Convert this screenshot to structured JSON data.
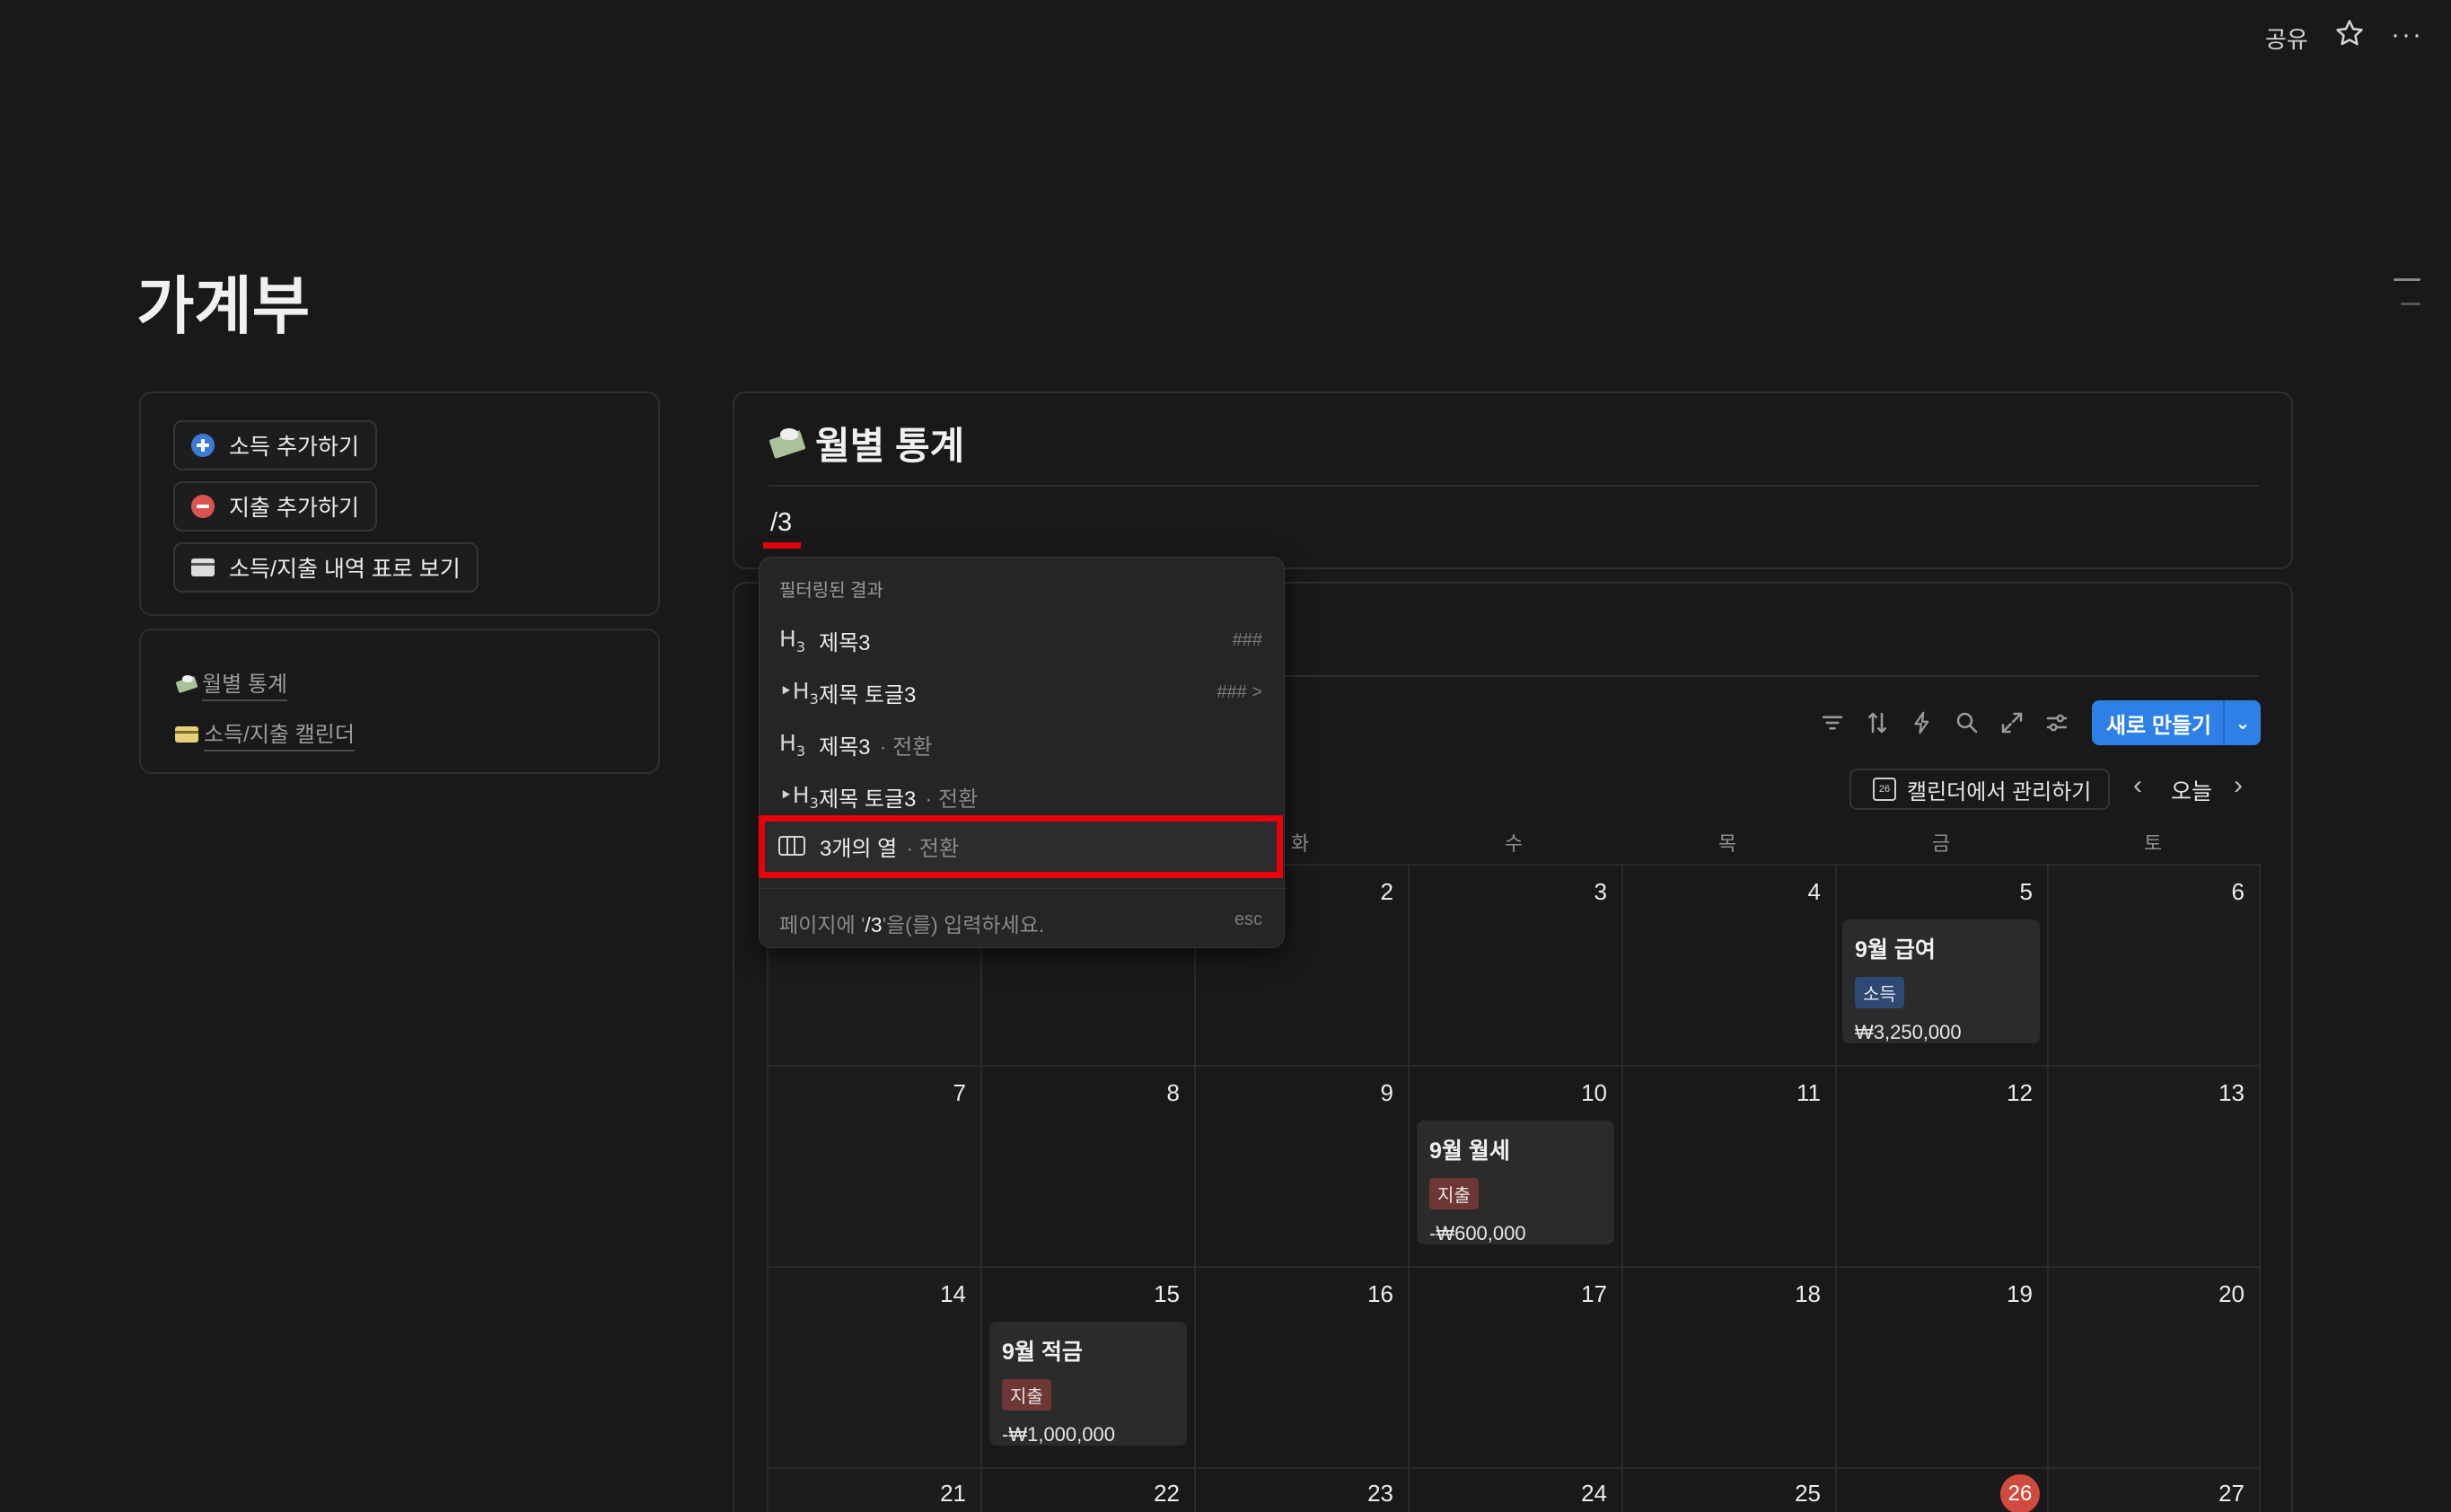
{
  "topbar": {
    "share": "공유",
    "star_icon": "star-icon",
    "more_icon": "more-icon"
  },
  "page": {
    "title": "가계부"
  },
  "left_panel": {
    "buttons": [
      {
        "label": "소득 추가하기",
        "icon": "plus-circle-icon"
      },
      {
        "label": "지출 추가하기",
        "icon": "minus-circle-icon"
      },
      {
        "label": "소득/지출 내역 표로 보기",
        "icon": "card-icon"
      }
    ],
    "links": [
      {
        "label": "월별 통계",
        "icon": "money-wings-icon"
      },
      {
        "label": "소득/지출 캘린더",
        "icon": "credit-card-icon"
      }
    ]
  },
  "stats_block": {
    "title": "월별 통계",
    "typed_text": "/3"
  },
  "popup": {
    "header": "필터링된 결과",
    "items": [
      {
        "icon_main": "H",
        "icon_sub": "3",
        "icon_prefix": "",
        "label": "제목3",
        "dim": "",
        "shortcut": "###"
      },
      {
        "icon_main": "H",
        "icon_sub": "3",
        "icon_prefix": "‣",
        "label": "제목 토글3",
        "dim": "",
        "shortcut": "### >"
      },
      {
        "icon_main": "H",
        "icon_sub": "3",
        "icon_prefix": "",
        "label": "제목3",
        "dim": "· 전환",
        "shortcut": ""
      },
      {
        "icon_main": "H",
        "icon_sub": "3",
        "icon_prefix": "‣",
        "label": "제목 토글3",
        "dim": "· 전환",
        "shortcut": ""
      },
      {
        "icon_main": "",
        "icon_sub": "",
        "icon_prefix": "",
        "label": "3개의 열",
        "dim": "· 전환",
        "shortcut": ""
      }
    ],
    "footer_prefix": "페이지에 '",
    "footer_query": "/3",
    "footer_suffix": "'을(를) 입력하세요.",
    "esc": "esc"
  },
  "calendar": {
    "new_button": "새로 만들기",
    "manage_button": "캘린더에서 관리하기",
    "manage_icon_text": "26",
    "today": "오늘",
    "weekdays_visible": [
      "화",
      "수",
      "목",
      "금",
      "토"
    ],
    "weeks": [
      [
        "",
        "",
        "2",
        "3",
        "4",
        "5",
        "6"
      ],
      [
        "7",
        "8",
        "9",
        "10",
        "11",
        "12",
        "13"
      ],
      [
        "14",
        "15",
        "16",
        "17",
        "18",
        "19",
        "20"
      ],
      [
        "21",
        "22",
        "23",
        "24",
        "25",
        "26",
        "27"
      ]
    ],
    "today_date": "26",
    "events": [
      {
        "title": "9월 급여",
        "tag": "소득",
        "amount": "₩3,250,000",
        "type": "income"
      },
      {
        "title": "9월 월세",
        "tag": "지출",
        "amount": "-₩600,000",
        "type": "expense"
      },
      {
        "title": "9월 적금",
        "tag": "지출",
        "amount": "-₩1,000,000",
        "type": "expense"
      }
    ]
  },
  "colors": {
    "background": "#191919",
    "accent_blue": "#2f80e6",
    "highlight_red": "#e8000d",
    "today_red": "#d14a3e",
    "income_tag": "#2e4a74",
    "expense_tag": "#6e3634"
  }
}
